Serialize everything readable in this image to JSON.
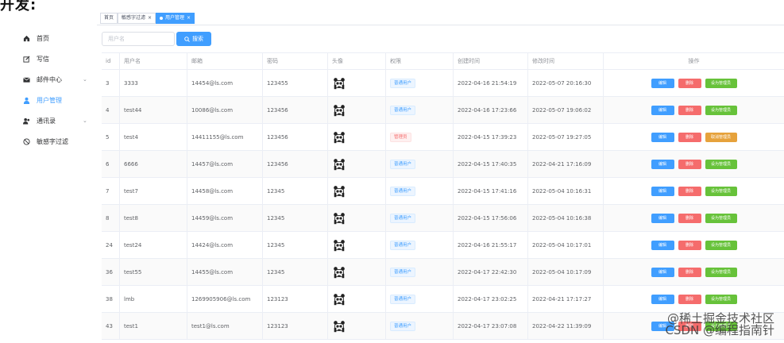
{
  "fragment_text": "开发:",
  "sidebar": {
    "items": [
      {
        "label": "首页",
        "icon": "home-icon"
      },
      {
        "label": "写信",
        "icon": "edit-icon"
      },
      {
        "label": "邮件中心",
        "icon": "mail-icon",
        "expandable": true
      },
      {
        "label": "用户管理",
        "icon": "user-icon",
        "active": true
      },
      {
        "label": "通讯录",
        "icon": "contacts-icon",
        "expandable": true
      },
      {
        "label": "敏感字过滤",
        "icon": "filter-icon"
      }
    ]
  },
  "tags": [
    {
      "label": "首页",
      "active": false
    },
    {
      "label": "敏感字过滤",
      "active": false,
      "closable": true
    },
    {
      "label": "用户管理",
      "active": true,
      "closable": true
    }
  ],
  "search": {
    "placeholder": "用户名",
    "button_label": "搜索"
  },
  "table": {
    "headers": [
      "id",
      "用户名",
      "邮箱",
      "密码",
      "头像",
      "权限",
      "创建时间",
      "修改时间",
      "操作"
    ],
    "rows": [
      {
        "id": "3",
        "username": "3333",
        "email": "14454@ls.com",
        "password": "123455",
        "role": "普通用户",
        "role_type": "normal",
        "created": "2022-04-16 21:54:19",
        "modified": "2022-05-07 20:16:30",
        "set_label": "设为管理员",
        "set_type": "success"
      },
      {
        "id": "4",
        "username": "test44",
        "email": "10086@ls.com",
        "password": "123456",
        "role": "普通用户",
        "role_type": "normal",
        "created": "2022-04-16 17:23:66",
        "modified": "2022-05-07 19:06:02",
        "set_label": "设为管理员",
        "set_type": "success"
      },
      {
        "id": "5",
        "username": "test4",
        "email": "14411155@ls.com",
        "password": "123456",
        "role": "管理员",
        "role_type": "admin",
        "created": "2022-04-15 17:39:23",
        "modified": "2022-05-07 19:27:05",
        "set_label": "取消管理员",
        "set_type": "warning"
      },
      {
        "id": "6",
        "username": "6666",
        "email": "14457@ls.com",
        "password": "123456",
        "role": "普通用户",
        "role_type": "normal",
        "created": "2022-04-15 17:40:35",
        "modified": "2022-04-21 17:16:09",
        "set_label": "设为管理员",
        "set_type": "success"
      },
      {
        "id": "7",
        "username": "test7",
        "email": "14458@ls.com",
        "password": "12345",
        "role": "普通用户",
        "role_type": "normal",
        "created": "2022-04-15 17:41:16",
        "modified": "2022-05-04 10:16:31",
        "set_label": "设为管理员",
        "set_type": "success"
      },
      {
        "id": "8",
        "username": "test8",
        "email": "14459@ls.com",
        "password": "12345",
        "role": "普通用户",
        "role_type": "normal",
        "created": "2022-04-15 17:56:06",
        "modified": "2022-05-04 10:16:38",
        "set_label": "设为管理员",
        "set_type": "success"
      },
      {
        "id": "24",
        "username": "test24",
        "email": "14424@ls.com",
        "password": "12345",
        "role": "普通用户",
        "role_type": "normal",
        "created": "2022-04-16 21:55:17",
        "modified": "2022-05-04 10:17:01",
        "set_label": "设为管理员",
        "set_type": "success"
      },
      {
        "id": "36",
        "username": "test55",
        "email": "14455@ls.com",
        "password": "12345",
        "role": "普通用户",
        "role_type": "normal",
        "created": "2022-04-17 22:42:30",
        "modified": "2022-05-04 10:17:09",
        "set_label": "设为管理员",
        "set_type": "success"
      },
      {
        "id": "38",
        "username": "lmb",
        "email": "1269905906@ls.com",
        "password": "123123",
        "role": "普通用户",
        "role_type": "normal",
        "created": "2022-04-17 23:02:25",
        "modified": "2022-04-21 17:17:27",
        "set_label": "设为管理员",
        "set_type": "success"
      },
      {
        "id": "43",
        "username": "test1",
        "email": "test1@ls.com",
        "password": "123123",
        "role": "普通用户",
        "role_type": "normal",
        "created": "2022-04-17 23:07:08",
        "modified": "2022-04-22 11:39:09",
        "set_label": "设为管理员",
        "set_type": "success"
      }
    ],
    "edit_label": "编辑",
    "delete_label": "删除"
  },
  "watermark": {
    "line1": "@稀土掘金技术社区",
    "line2": "CSDN @编程指南针"
  },
  "colors": {
    "primary": "#409eff",
    "danger": "#f56c6c",
    "success": "#67c23a",
    "warning": "#e6a23c"
  }
}
